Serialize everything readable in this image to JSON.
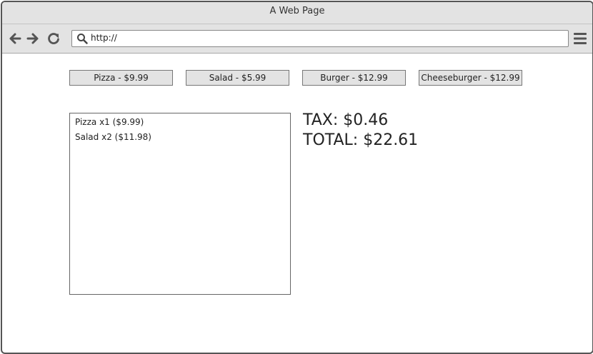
{
  "window": {
    "title": "A Web Page"
  },
  "browser": {
    "url": "http://"
  },
  "menu_buttons": [
    {
      "label": "Pizza - $9.99"
    },
    {
      "label": "Salad - $5.99"
    },
    {
      "label": "Burger - $12.99"
    },
    {
      "label": "Cheeseburger - $12.99"
    }
  ],
  "order": {
    "items": [
      {
        "text": "Pizza x1 ($9.99)"
      },
      {
        "text": "Salad x2 ($11.98)"
      }
    ]
  },
  "summary": {
    "tax": "TAX: $0.46",
    "total": "TOTAL: $22.61"
  }
}
